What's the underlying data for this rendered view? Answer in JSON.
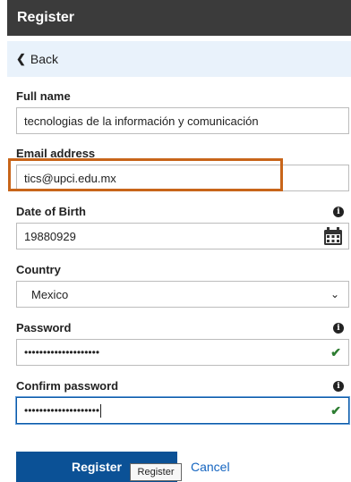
{
  "header": {
    "title": "Register"
  },
  "nav": {
    "back_label": "Back"
  },
  "form": {
    "full_name": {
      "label": "Full name",
      "value": "tecnologias de la información y comunicación"
    },
    "email": {
      "label": "Email address",
      "value": "tics@upci.edu.mx"
    },
    "dob": {
      "label": "Date of Birth",
      "value": "19880929"
    },
    "country": {
      "label": "Country",
      "value": "Mexico"
    },
    "password": {
      "label": "Password",
      "value": "••••••••••••••••••••"
    },
    "confirm_password": {
      "label": "Confirm password",
      "value": "••••••••••••••••••••"
    }
  },
  "actions": {
    "register_label": "Register",
    "cancel_label": "Cancel",
    "tooltip": "Register"
  },
  "colors": {
    "header_bg": "#3b3b3b",
    "primary": "#0b5196",
    "highlight": "#c8651a",
    "valid": "#2e7d32"
  }
}
